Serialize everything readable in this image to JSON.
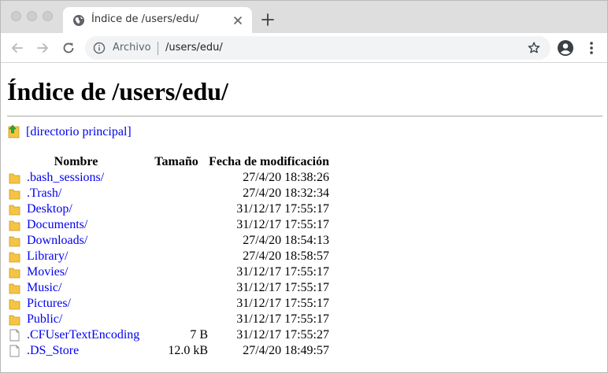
{
  "browser": {
    "tab": {
      "title": "Índice de /users/edu/",
      "icon": "globe-icon"
    },
    "omnibox": {
      "secure_label": "Archivo",
      "url": "/users/edu/"
    }
  },
  "page": {
    "title": "Índice de /users/edu/",
    "parent_link": "[directorio principal]",
    "headers": {
      "name": "Nombre",
      "size": "Tamaño",
      "date": "Fecha de modificación"
    },
    "rows": [
      {
        "name": ".bash_sessions/",
        "size": "",
        "date": "27/4/20 18:38:26",
        "type": "folder"
      },
      {
        "name": ".Trash/",
        "size": "",
        "date": "27/4/20 18:32:34",
        "type": "folder"
      },
      {
        "name": "Desktop/",
        "size": "",
        "date": "31/12/17 17:55:17",
        "type": "folder"
      },
      {
        "name": "Documents/",
        "size": "",
        "date": "31/12/17 17:55:17",
        "type": "folder"
      },
      {
        "name": "Downloads/",
        "size": "",
        "date": "27/4/20 18:54:13",
        "type": "folder"
      },
      {
        "name": "Library/",
        "size": "",
        "date": "27/4/20 18:58:57",
        "type": "folder"
      },
      {
        "name": "Movies/",
        "size": "",
        "date": "31/12/17 17:55:17",
        "type": "folder"
      },
      {
        "name": "Music/",
        "size": "",
        "date": "31/12/17 17:55:17",
        "type": "folder"
      },
      {
        "name": "Pictures/",
        "size": "",
        "date": "31/12/17 17:55:17",
        "type": "folder"
      },
      {
        "name": "Public/",
        "size": "",
        "date": "31/12/17 17:55:17",
        "type": "folder"
      },
      {
        "name": ".CFUserTextEncoding",
        "size": "7 B",
        "date": "31/12/17 17:55:27",
        "type": "file"
      },
      {
        "name": ".DS_Store",
        "size": "12.0 kB",
        "date": "27/4/20 18:49:57",
        "type": "file"
      }
    ]
  },
  "colors": {
    "link": "#0000ee",
    "folder": "#f6c445",
    "tab_strip": "#dedede"
  }
}
